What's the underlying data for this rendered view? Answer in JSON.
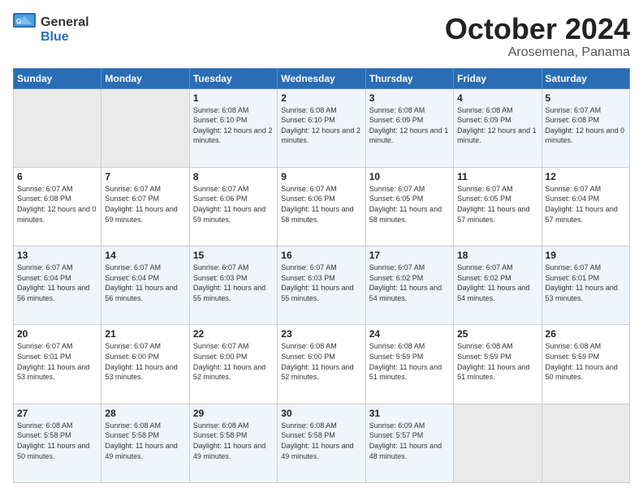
{
  "header": {
    "logo_general": "General",
    "logo_blue": "Blue",
    "month_title": "October 2024",
    "location": "Arosemena, Panama"
  },
  "days_of_week": [
    "Sunday",
    "Monday",
    "Tuesday",
    "Wednesday",
    "Thursday",
    "Friday",
    "Saturday"
  ],
  "weeks": [
    [
      {
        "day": "",
        "empty": true
      },
      {
        "day": "",
        "empty": true
      },
      {
        "day": "1",
        "sunrise": "Sunrise: 6:08 AM",
        "sunset": "Sunset: 6:10 PM",
        "daylight": "Daylight: 12 hours and 2 minutes."
      },
      {
        "day": "2",
        "sunrise": "Sunrise: 6:08 AM",
        "sunset": "Sunset: 6:10 PM",
        "daylight": "Daylight: 12 hours and 2 minutes."
      },
      {
        "day": "3",
        "sunrise": "Sunrise: 6:08 AM",
        "sunset": "Sunset: 6:09 PM",
        "daylight": "Daylight: 12 hours and 1 minute."
      },
      {
        "day": "4",
        "sunrise": "Sunrise: 6:08 AM",
        "sunset": "Sunset: 6:09 PM",
        "daylight": "Daylight: 12 hours and 1 minute."
      },
      {
        "day": "5",
        "sunrise": "Sunrise: 6:07 AM",
        "sunset": "Sunset: 6:08 PM",
        "daylight": "Daylight: 12 hours and 0 minutes."
      }
    ],
    [
      {
        "day": "6",
        "sunrise": "Sunrise: 6:07 AM",
        "sunset": "Sunset: 6:08 PM",
        "daylight": "Daylight: 12 hours and 0 minutes."
      },
      {
        "day": "7",
        "sunrise": "Sunrise: 6:07 AM",
        "sunset": "Sunset: 6:07 PM",
        "daylight": "Daylight: 11 hours and 59 minutes."
      },
      {
        "day": "8",
        "sunrise": "Sunrise: 6:07 AM",
        "sunset": "Sunset: 6:06 PM",
        "daylight": "Daylight: 11 hours and 59 minutes."
      },
      {
        "day": "9",
        "sunrise": "Sunrise: 6:07 AM",
        "sunset": "Sunset: 6:06 PM",
        "daylight": "Daylight: 11 hours and 58 minutes."
      },
      {
        "day": "10",
        "sunrise": "Sunrise: 6:07 AM",
        "sunset": "Sunset: 6:05 PM",
        "daylight": "Daylight: 11 hours and 58 minutes."
      },
      {
        "day": "11",
        "sunrise": "Sunrise: 6:07 AM",
        "sunset": "Sunset: 6:05 PM",
        "daylight": "Daylight: 11 hours and 57 minutes."
      },
      {
        "day": "12",
        "sunrise": "Sunrise: 6:07 AM",
        "sunset": "Sunset: 6:04 PM",
        "daylight": "Daylight: 11 hours and 57 minutes."
      }
    ],
    [
      {
        "day": "13",
        "sunrise": "Sunrise: 6:07 AM",
        "sunset": "Sunset: 6:04 PM",
        "daylight": "Daylight: 11 hours and 56 minutes."
      },
      {
        "day": "14",
        "sunrise": "Sunrise: 6:07 AM",
        "sunset": "Sunset: 6:04 PM",
        "daylight": "Daylight: 11 hours and 56 minutes."
      },
      {
        "day": "15",
        "sunrise": "Sunrise: 6:07 AM",
        "sunset": "Sunset: 6:03 PM",
        "daylight": "Daylight: 11 hours and 55 minutes."
      },
      {
        "day": "16",
        "sunrise": "Sunrise: 6:07 AM",
        "sunset": "Sunset: 6:03 PM",
        "daylight": "Daylight: 11 hours and 55 minutes."
      },
      {
        "day": "17",
        "sunrise": "Sunrise: 6:07 AM",
        "sunset": "Sunset: 6:02 PM",
        "daylight": "Daylight: 11 hours and 54 minutes."
      },
      {
        "day": "18",
        "sunrise": "Sunrise: 6:07 AM",
        "sunset": "Sunset: 6:02 PM",
        "daylight": "Daylight: 11 hours and 54 minutes."
      },
      {
        "day": "19",
        "sunrise": "Sunrise: 6:07 AM",
        "sunset": "Sunset: 6:01 PM",
        "daylight": "Daylight: 11 hours and 53 minutes."
      }
    ],
    [
      {
        "day": "20",
        "sunrise": "Sunrise: 6:07 AM",
        "sunset": "Sunset: 6:01 PM",
        "daylight": "Daylight: 11 hours and 53 minutes."
      },
      {
        "day": "21",
        "sunrise": "Sunrise: 6:07 AM",
        "sunset": "Sunset: 6:00 PM",
        "daylight": "Daylight: 11 hours and 53 minutes."
      },
      {
        "day": "22",
        "sunrise": "Sunrise: 6:07 AM",
        "sunset": "Sunset: 6:00 PM",
        "daylight": "Daylight: 11 hours and 52 minutes."
      },
      {
        "day": "23",
        "sunrise": "Sunrise: 6:08 AM",
        "sunset": "Sunset: 6:00 PM",
        "daylight": "Daylight: 11 hours and 52 minutes."
      },
      {
        "day": "24",
        "sunrise": "Sunrise: 6:08 AM",
        "sunset": "Sunset: 5:59 PM",
        "daylight": "Daylight: 11 hours and 51 minutes."
      },
      {
        "day": "25",
        "sunrise": "Sunrise: 6:08 AM",
        "sunset": "Sunset: 5:59 PM",
        "daylight": "Daylight: 11 hours and 51 minutes."
      },
      {
        "day": "26",
        "sunrise": "Sunrise: 6:08 AM",
        "sunset": "Sunset: 5:59 PM",
        "daylight": "Daylight: 11 hours and 50 minutes."
      }
    ],
    [
      {
        "day": "27",
        "sunrise": "Sunrise: 6:08 AM",
        "sunset": "Sunset: 5:58 PM",
        "daylight": "Daylight: 11 hours and 50 minutes."
      },
      {
        "day": "28",
        "sunrise": "Sunrise: 6:08 AM",
        "sunset": "Sunset: 5:58 PM",
        "daylight": "Daylight: 11 hours and 49 minutes."
      },
      {
        "day": "29",
        "sunrise": "Sunrise: 6:08 AM",
        "sunset": "Sunset: 5:58 PM",
        "daylight": "Daylight: 11 hours and 49 minutes."
      },
      {
        "day": "30",
        "sunrise": "Sunrise: 6:08 AM",
        "sunset": "Sunset: 5:58 PM",
        "daylight": "Daylight: 11 hours and 49 minutes."
      },
      {
        "day": "31",
        "sunrise": "Sunrise: 6:09 AM",
        "sunset": "Sunset: 5:57 PM",
        "daylight": "Daylight: 11 hours and 48 minutes."
      },
      {
        "day": "",
        "empty": true
      },
      {
        "day": "",
        "empty": true
      }
    ]
  ]
}
